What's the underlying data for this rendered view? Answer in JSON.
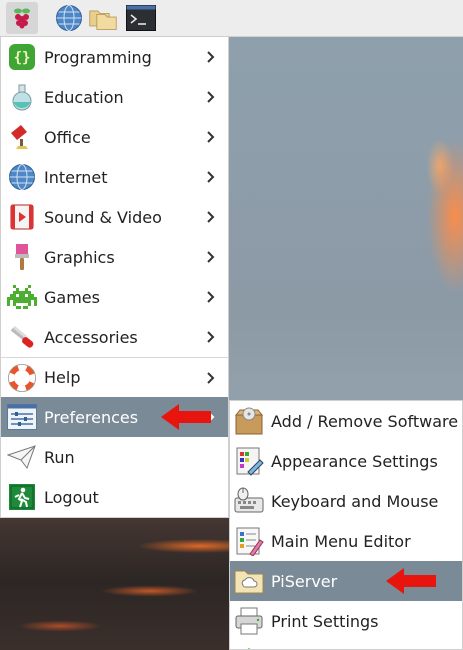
{
  "taskbar": {
    "icons": [
      "raspberry-icon",
      "web-browser-icon",
      "file-manager-icon",
      "terminal-icon"
    ]
  },
  "menu": {
    "items": [
      {
        "label": "Programming",
        "icon": "programming-icon"
      },
      {
        "label": "Education",
        "icon": "education-icon"
      },
      {
        "label": "Office",
        "icon": "office-icon"
      },
      {
        "label": "Internet",
        "icon": "internet-icon"
      },
      {
        "label": "Sound & Video",
        "icon": "sound-video-icon"
      },
      {
        "label": "Graphics",
        "icon": "graphics-icon"
      },
      {
        "label": "Games",
        "icon": "games-icon"
      },
      {
        "label": "Accessories",
        "icon": "accessories-icon"
      },
      {
        "label": "Help",
        "icon": "help-icon"
      },
      {
        "label": "Preferences",
        "icon": "preferences-icon",
        "active": true
      },
      {
        "label": "Run",
        "icon": "run-icon"
      },
      {
        "label": "Logout",
        "icon": "logout-icon"
      }
    ]
  },
  "submenu": {
    "items": [
      {
        "label": "Add / Remove Software",
        "icon": "add-remove-software-icon"
      },
      {
        "label": "Appearance Settings",
        "icon": "appearance-settings-icon"
      },
      {
        "label": "Keyboard and Mouse",
        "icon": "keyboard-mouse-icon"
      },
      {
        "label": "Main Menu Editor",
        "icon": "main-menu-editor-icon"
      },
      {
        "label": "PiServer",
        "icon": "piserver-icon",
        "active": true
      },
      {
        "label": "Print Settings",
        "icon": "print-settings-icon"
      }
    ]
  },
  "colors": {
    "highlight": "#7b8a97",
    "annotation_arrow": "#e8140e"
  }
}
